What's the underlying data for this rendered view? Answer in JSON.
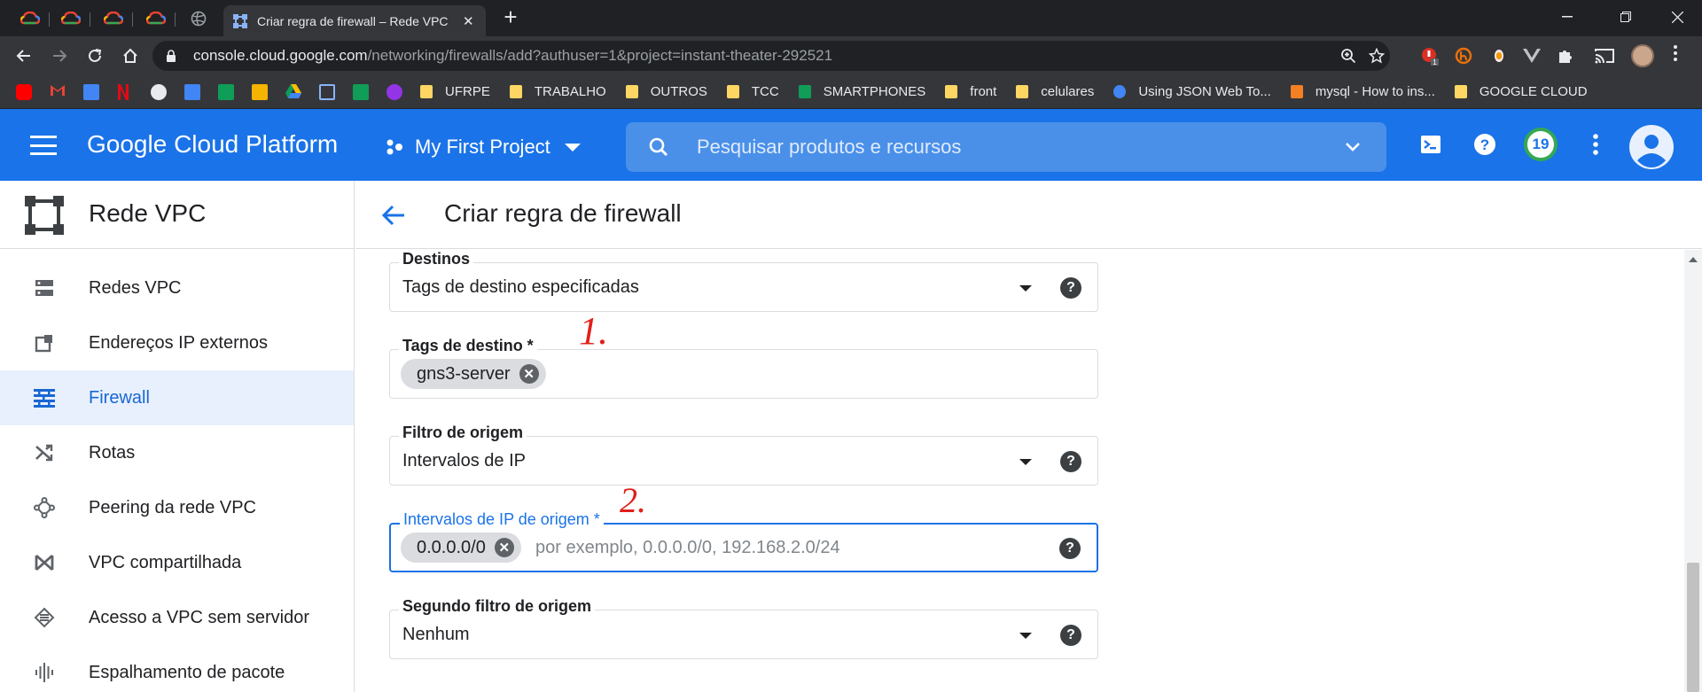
{
  "browser": {
    "active_tab_title": "Criar regra de firewall – Rede VPC",
    "tab_close": "✕",
    "new_tab": "+",
    "url_host": "console.cloud.google.com",
    "url_path": "/networking/firewalls/add?authuser=1&project=instant-theater-292521",
    "bookmarks": [
      "UFRPE",
      "TRABALHO",
      "OUTROS",
      "TCC",
      "SMARTPHONES",
      "front",
      "celulares",
      "Using JSON Web To...",
      "mysql - How to ins...",
      "GOOGLE CLOUD"
    ],
    "ext_badge": "1"
  },
  "header": {
    "brand": "Google Cloud Platform",
    "project": "My First Project",
    "search_placeholder": "Pesquisar produtos e recursos",
    "notification_count": "19"
  },
  "nav": {
    "title": "Rede VPC",
    "items": [
      {
        "label": "Redes VPC",
        "icon": "vpc-networks-icon"
      },
      {
        "label": "Endereços IP externos",
        "icon": "external-ip-icon"
      },
      {
        "label": "Firewall",
        "icon": "firewall-icon"
      },
      {
        "label": "Rotas",
        "icon": "routes-icon"
      },
      {
        "label": "Peering da rede VPC",
        "icon": "peering-icon"
      },
      {
        "label": "VPC compartilhada",
        "icon": "shared-vpc-icon"
      },
      {
        "label": "Acesso a VPC sem servidor",
        "icon": "serverless-access-icon"
      },
      {
        "label": "Espalhamento de pacote",
        "icon": "packet-mirroring-icon"
      }
    ],
    "active_index": 2
  },
  "page": {
    "title": "Criar regra de firewall"
  },
  "form": {
    "destinos": {
      "label": "Destinos",
      "value": "Tags de destino especificadas"
    },
    "tags_destino": {
      "label": "Tags de destino *",
      "chip": "gns3-server"
    },
    "filtro_origem": {
      "label": "Filtro de origem",
      "value": "Intervalos de IP"
    },
    "intervalos_ip": {
      "label": "Intervalos de IP de origem *",
      "chip": "0.0.0.0/0",
      "placeholder": "por exemplo, 0.0.0.0/0, 192.168.2.0/24"
    },
    "segundo_filtro": {
      "label": "Segundo filtro de origem",
      "value": "Nenhum"
    }
  },
  "annotations": [
    "1.",
    "2."
  ],
  "colors": {
    "gcp_blue": "#1a73e8",
    "active_nav_bg": "#e8f0fe",
    "annotation_red": "#e0201a",
    "chrome_dark": "#202124"
  }
}
